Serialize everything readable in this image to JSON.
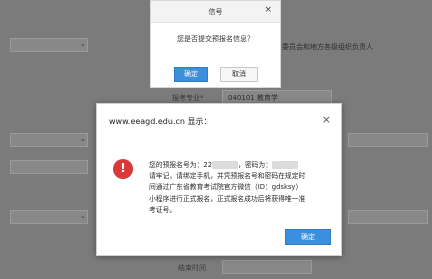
{
  "background_form": {
    "right_text_top": "委员会和地方各级组织负责人",
    "subject_label": "报考专业*",
    "subject_value": "040101 教育学",
    "bottom_label": "结束时间"
  },
  "confirm_dialog": {
    "title": "信号",
    "message": "您是否提交预报名信息？",
    "confirm_label": "确定",
    "cancel_label": "取消"
  },
  "alert_dialog": {
    "title": "www.eeagd.edu.cn 显示：",
    "line1_prefix": "您的预报名号为：22",
    "line1_mid": "，密码为：",
    "line2": "请牢记，请绑定手机，并凭预报名号和密码在规定时",
    "line3": "间通过广东省教育考试院官方微信（ID：gdsksy）",
    "line4": "小程序进行正式报名，正式报名成功后将获得唯一准",
    "line5": "考证号。",
    "ok_label": "确定"
  },
  "colors": {
    "accent": "#3b8fdc",
    "error_icon": "#d83a3a"
  }
}
